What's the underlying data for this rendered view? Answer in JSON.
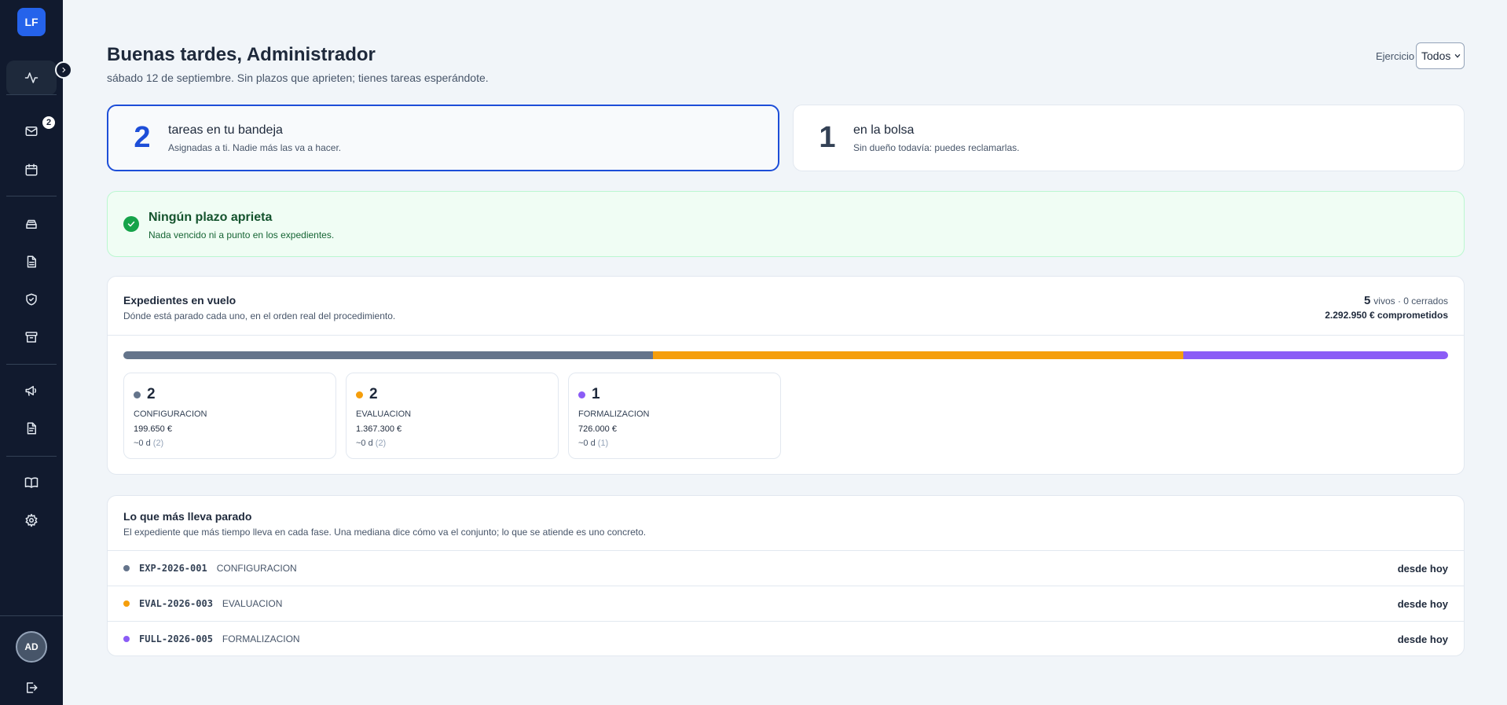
{
  "sidebar": {
    "logo": "LF",
    "inbox_badge": "2",
    "avatar": "AD",
    "items": [
      {
        "name": "activity-icon"
      },
      {
        "name": "mail-icon"
      },
      {
        "name": "calendar-icon"
      },
      {
        "name": "inbox-tray-icon"
      },
      {
        "name": "document-icon"
      },
      {
        "name": "shield-check-icon"
      },
      {
        "name": "archive-icon"
      },
      {
        "name": "megaphone-icon"
      },
      {
        "name": "document-text-icon"
      },
      {
        "name": "book-icon"
      },
      {
        "name": "gear-icon"
      },
      {
        "name": "logout-icon"
      }
    ]
  },
  "header": {
    "greeting": "Buenas tardes, Administrador",
    "subtitle": "sábado 12 de septiembre. Sin plazos que aprieten; tienes tareas esperándote.",
    "exercise_label": "Ejercicio",
    "exercise_value": "Todos"
  },
  "stats": {
    "inbox": {
      "count": "2",
      "title": "tareas en tu bandeja",
      "desc": "Asignadas a ti. Nadie más las va a hacer."
    },
    "pool": {
      "count": "1",
      "title": "en la bolsa",
      "desc": "Sin dueño todavía: puedes reclamarlas."
    }
  },
  "alert": {
    "title": "Ningún plazo aprieta",
    "desc": "Nada vencido ni a punto en los expedientes."
  },
  "flight": {
    "title": "Expedientes en vuelo",
    "desc": "Dónde está parado cada uno, en el orden real del procedimiento.",
    "live_count": "5",
    "live_rest": "vivos · 0 cerrados",
    "committed": "2.292.950 € comprometidos",
    "phases": [
      {
        "count": "2",
        "name": "CONFIGURACION",
        "amount": "199.650 €",
        "days": "~0 d",
        "days_n": "(2)",
        "color": "#64748b",
        "share": 2
      },
      {
        "count": "2",
        "name": "EVALUACION",
        "amount": "1.367.300 €",
        "days": "~0 d",
        "days_n": "(2)",
        "color": "#f59e0b",
        "share": 2
      },
      {
        "count": "1",
        "name": "FORMALIZACION",
        "amount": "726.000 €",
        "days": "~0 d",
        "days_n": "(1)",
        "color": "#8b5cf6",
        "share": 1
      }
    ]
  },
  "stalled": {
    "title": "Lo que más lleva parado",
    "desc": "El expediente que más tiempo lleva en cada fase. Una mediana dice cómo va el conjunto; lo que se atiende es uno concreto.",
    "rows": [
      {
        "code": "EXP-2026-001",
        "phase": "CONFIGURACION",
        "since": "desde hoy",
        "color": "#64748b"
      },
      {
        "code": "EVAL-2026-003",
        "phase": "EVALUACION",
        "since": "desde hoy",
        "color": "#f59e0b"
      },
      {
        "code": "FULL-2026-005",
        "phase": "FORMALIZACION",
        "since": "desde hoy",
        "color": "#8b5cf6"
      }
    ]
  }
}
